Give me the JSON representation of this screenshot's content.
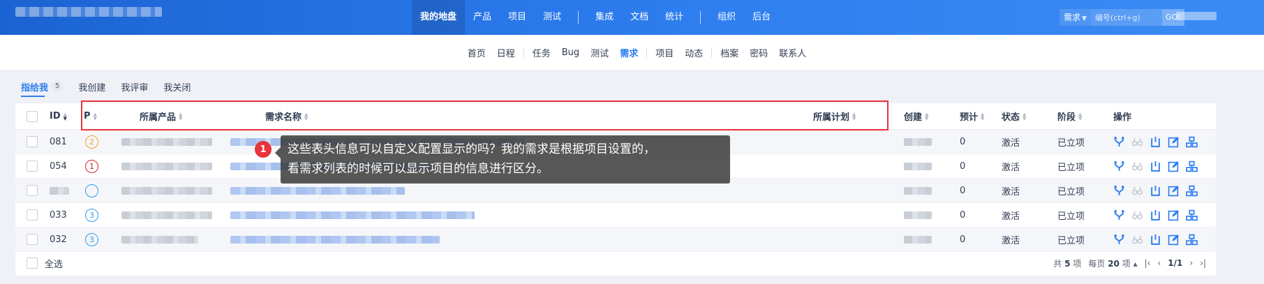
{
  "topbar": {
    "nav": [
      "我的地盘",
      "产品",
      "项目",
      "测试",
      "集成",
      "文档",
      "统计",
      "组织",
      "后台"
    ],
    "active_index": 0,
    "search": {
      "type": "需求",
      "placeholder": "编号(ctrl+g)",
      "go": "GO!"
    }
  },
  "subnav": [
    "首页",
    "日程",
    "任务",
    "Bug",
    "测试",
    "需求",
    "项目",
    "动态",
    "档案",
    "密码",
    "联系人"
  ],
  "subnav_active": "需求",
  "filters": {
    "tabs": [
      "指给我",
      "我创建",
      "我评审",
      "我关闭"
    ],
    "active_count": "5"
  },
  "table": {
    "headers": {
      "id": "ID",
      "pri": "P",
      "product": "所属产品",
      "title": "需求名称",
      "plan": "所属计划",
      "creator": "创建",
      "estimate": "预计",
      "status": "状态",
      "stage": "阶段",
      "actions": "操作"
    },
    "rows": [
      {
        "id": "081",
        "pri": "2",
        "estimate": "0",
        "status": "激活",
        "stage": "已立项"
      },
      {
        "id": "054",
        "pri": "1",
        "estimate": "0",
        "status": "激活",
        "stage": "已立项"
      },
      {
        "id": "",
        "pri": "",
        "estimate": "0",
        "status": "激活",
        "stage": "已立项"
      },
      {
        "id": "033",
        "pri": "3",
        "estimate": "0",
        "status": "激活",
        "stage": "已立项"
      },
      {
        "id": "032",
        "pri": "3",
        "estimate": "0",
        "status": "激活",
        "stage": "已立项"
      }
    ],
    "footer": {
      "select_all": "全选",
      "total_prefix": "共",
      "total": "5",
      "total_suffix": "项",
      "per_page_prefix": "每页",
      "per_page": "20",
      "per_page_suffix": "项",
      "page": "1/1"
    }
  },
  "annotation": {
    "number": "1",
    "line1": "这些表头信息可以自定义配置显示的吗？我的需求是根据项目设置的，",
    "line2": "看需求列表的时候可以显示项目的信息进行区分。"
  },
  "colors": {
    "accent": "#2e7ef0",
    "annotation_red": "#e8343a",
    "pri1": "#d9232a",
    "pri2": "#f1a02a",
    "pri3": "#2e9ce8"
  }
}
